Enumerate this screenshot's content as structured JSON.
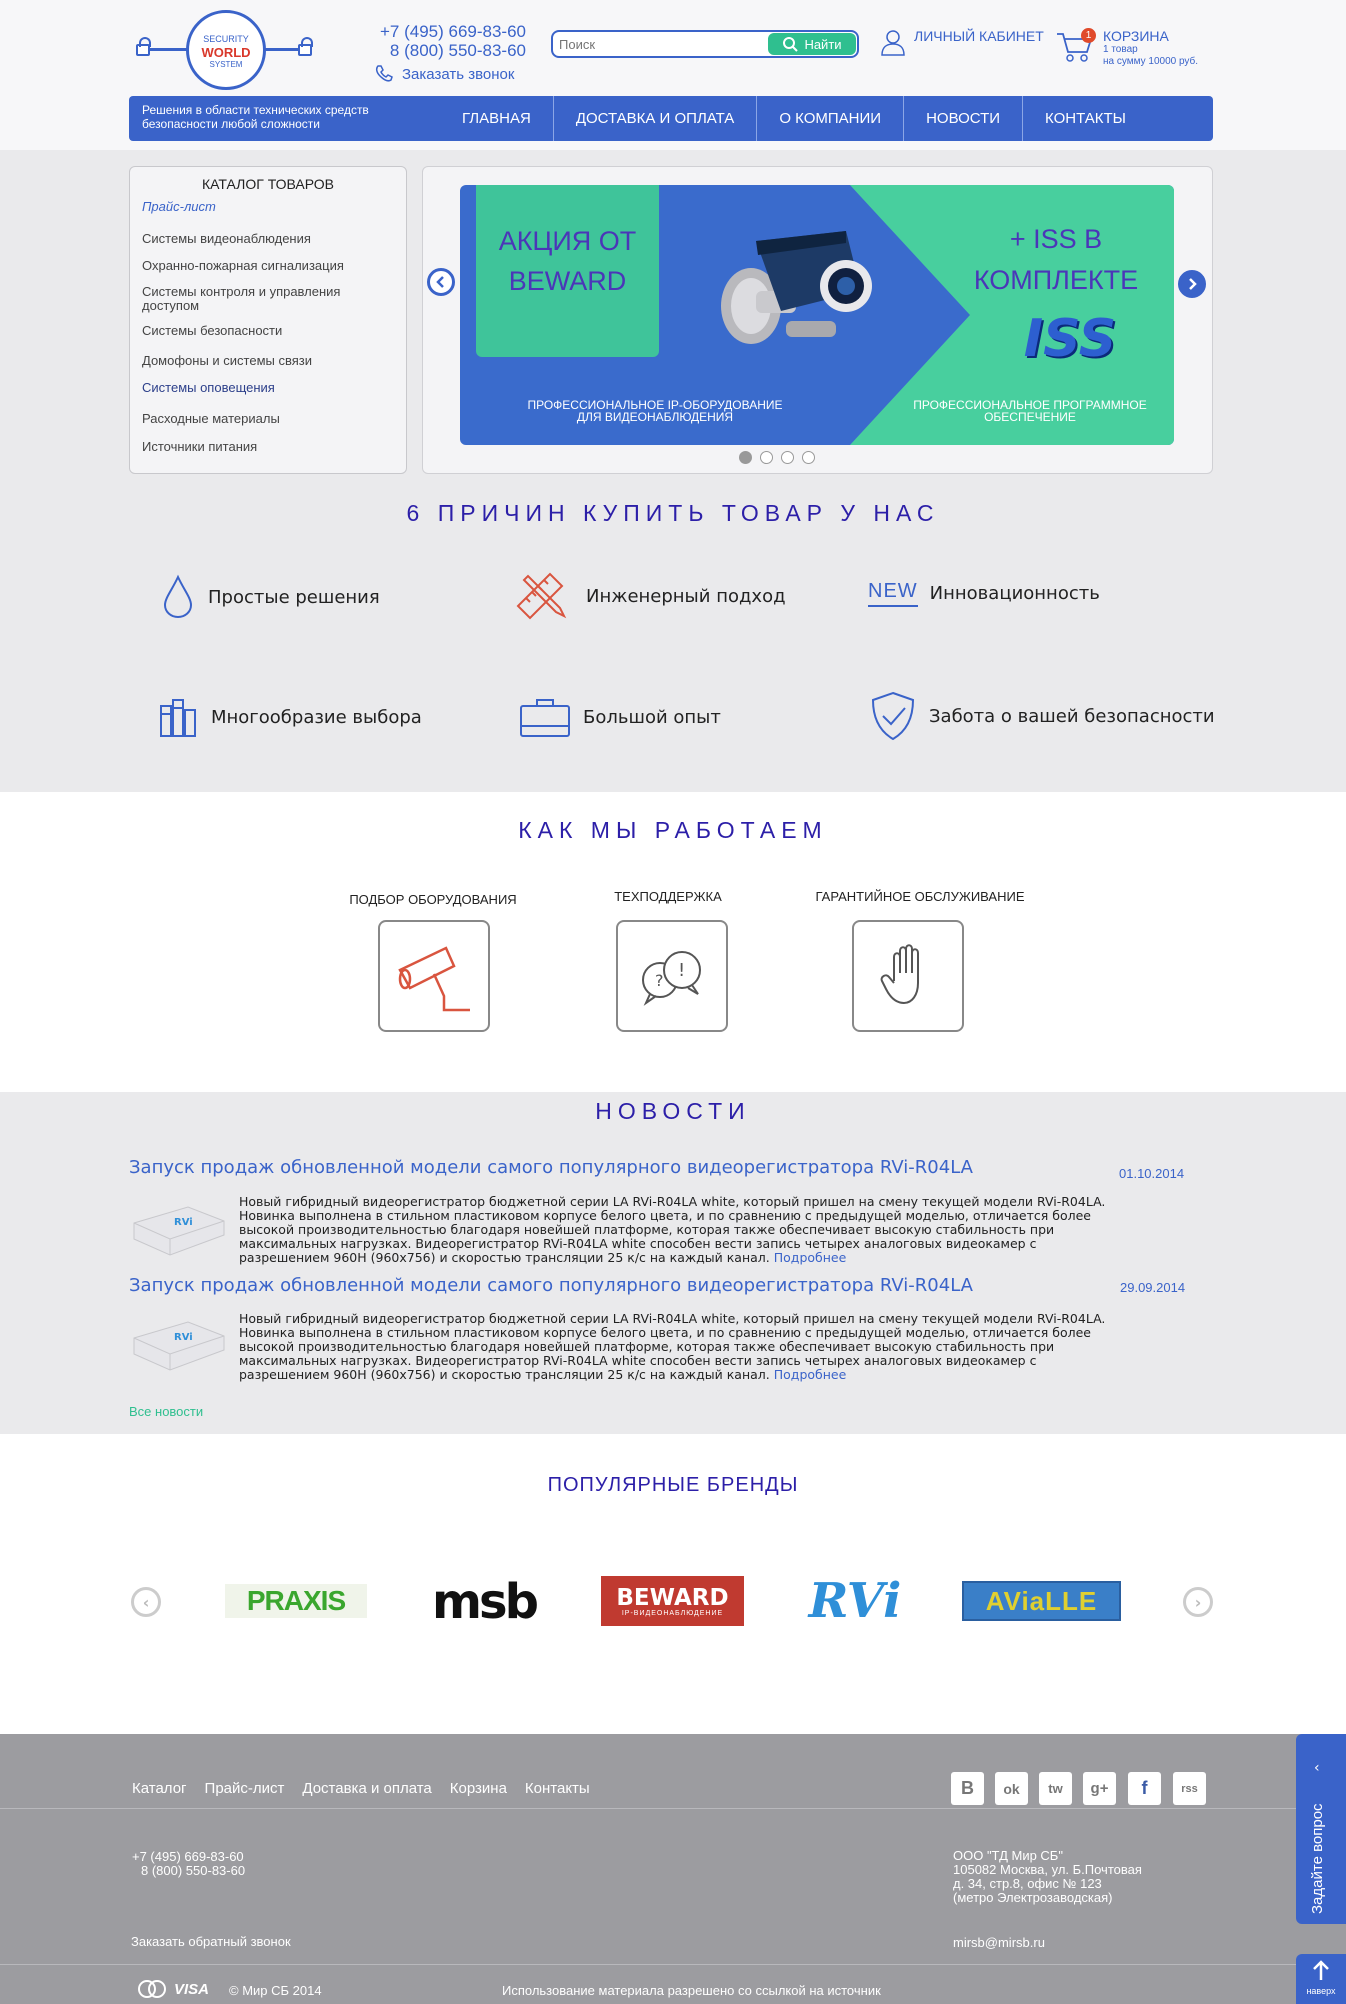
{
  "logo": {
    "line1": "SECURITY",
    "line2": "WORLD",
    "line3": "SYSTEM"
  },
  "header": {
    "phone1": "+7 (495) 669-83-60",
    "phone2": "8 (800) 550-83-60",
    "callback": "Заказать звонок",
    "search_placeholder": "Поиск",
    "search_button": "Найти",
    "cabinet": "ЛИЧНЫЙ КАБИНЕТ",
    "cart_title": "КОРЗИНА",
    "cart_count": "1",
    "cart_items": "1 товар",
    "cart_sum": "на сумму 10000 руб."
  },
  "navbar": {
    "tagline": "Решения в области технических средств безопасности любой сложности",
    "items": [
      "ГЛАВНАЯ",
      "ДОСТАВКА И ОПЛАТА",
      "О КОМПАНИИ",
      "НОВОСТИ",
      "КОНТАКТЫ"
    ]
  },
  "catalog": {
    "title": "КАТАЛОГ ТОВАРОВ",
    "pricelist": "Прайс-лист",
    "items": [
      "Системы видеонаблюдения",
      "Охранно-пожарная сигнализация",
      "Системы контроля и управления доступом",
      "Системы безопасности",
      "Домофоны и системы связи",
      "Системы оповещения",
      "Расходные материалы",
      "Источники питания"
    ]
  },
  "banner": {
    "promo": "АКЦИЯ ОТ BEWARD",
    "iss": "+ ISS В КОМПЛЕКТЕ",
    "iss_logo": "ISS",
    "caption_left": "ПРОФЕССИОНАЛЬНОЕ IP-ОБОРУДОВАНИЕ ДЛЯ ВИДЕОНАБЛЮДЕНИЯ",
    "caption_right": "ПРОФЕССИОНАЛЬНОЕ ПРОГРАММНОЕ ОБЕСПЕЧЕНИЕ",
    "slides": 4,
    "active_slide": 1
  },
  "reasons": {
    "title": "6 ПРИЧИН КУПИТЬ ТОВАР У НАС",
    "items": [
      "Простые решения",
      "Инженерный подход",
      "Инновационность",
      "Многообразие выбора",
      "Большой опыт",
      "Забота о вашей безопасности"
    ],
    "new_badge": "NEW"
  },
  "how": {
    "title": "КАК МЫ РАБОТАЕМ",
    "items": [
      "ПОДБОР ОБОРУДОВАНИЯ",
      "ТЕХПОДДЕРЖКА",
      "ГАРАНТИЙНОЕ ОБСЛУЖИВАНИЕ"
    ]
  },
  "news": {
    "title": "НОВОСТИ",
    "items": [
      {
        "title": "Запуск продаж обновленной модели самого популярного видеорегистратора RVi-R04LA",
        "date": "01.10.2014",
        "text": "Новый гибридный видеорегистратор бюджетной серии LA RVi-R04LA white, который пришел на смену текущей модели RVi-R04LA. Новинка выполнена в стильном пластиковом корпусе белого цвета, и по сравнению с предыдущей моделью, отличается более высокой производительностью благодаря новейшей платформе, которая также обеспечивает высокую стабильность при максимальных нагрузках. Видеорегистратор RVi-R04LA white способен вести запись четырех аналоговых видеокамер с разрешением 960H (960x756) и скоростью трансляции 25 к/с на каждый канал.",
        "more": "Подробнее"
      },
      {
        "title": "Запуск продаж обновленной модели самого популярного видеорегистратора RVi-R04LA",
        "date": "29.09.2014",
        "text": "Новый гибридный видеорегистратор бюджетной серии LA RVi-R04LA white, который пришел на смену текущей модели RVi-R04LA. Новинка выполнена в стильном пластиковом корпусе белого цвета, и по сравнению с предыдущей моделью, отличается более высокой производительностью благодаря новейшей платформе, которая также обеспечивает высокую стабильность при максимальных нагрузках. Видеорегистратор RVi-R04LA white способен вести запись четырех аналоговых видеокамер с разрешением 960H (960x756) и скоростью трансляции 25 к/с на каждый канал.",
        "more": "Подробнее"
      }
    ],
    "device_label": "RVi",
    "all": "Все новости"
  },
  "brands": {
    "title": "ПОПУЛЯРНЫЕ БРЕНДЫ",
    "items": [
      "PRAXIS",
      "msb",
      "BEWARD",
      "RVi",
      "AViaLLE"
    ],
    "beward_sub": "IP-ВИДЕОНАБЛЮДЕНИЕ"
  },
  "footer": {
    "nav": [
      "Каталог",
      "Прайс-лист",
      "Доставка и оплата",
      "Корзина",
      "Контакты"
    ],
    "social": [
      "В",
      "ok",
      "tw",
      "g+",
      "f",
      "rss"
    ],
    "phone1": "+7 (495) 669-83-60",
    "phone2": "8 (800) 550-83-60",
    "callback": "Заказать обратный звонок",
    "company": "ООО \"ТД Мир СБ\"",
    "address1": "105082 Москва, ул. Б.Почтовая",
    "address2": "д. 34, стр.8, офис № 123",
    "address3": "(метро Электрозаводская)",
    "email": "mirsb@mirsb.ru",
    "payment": "VISA",
    "copyright": "© Мир СБ 2014",
    "notice": "Использование материала разрешено со ссылкой на источник",
    "ask": "Задайте вопрос",
    "up": "наверх"
  },
  "colors": {
    "brand_blue": "#3a63c9",
    "accent_green": "#2fbf8f",
    "title_violet": "#2c1fa8",
    "footer_grey": "#9c9ca0"
  }
}
